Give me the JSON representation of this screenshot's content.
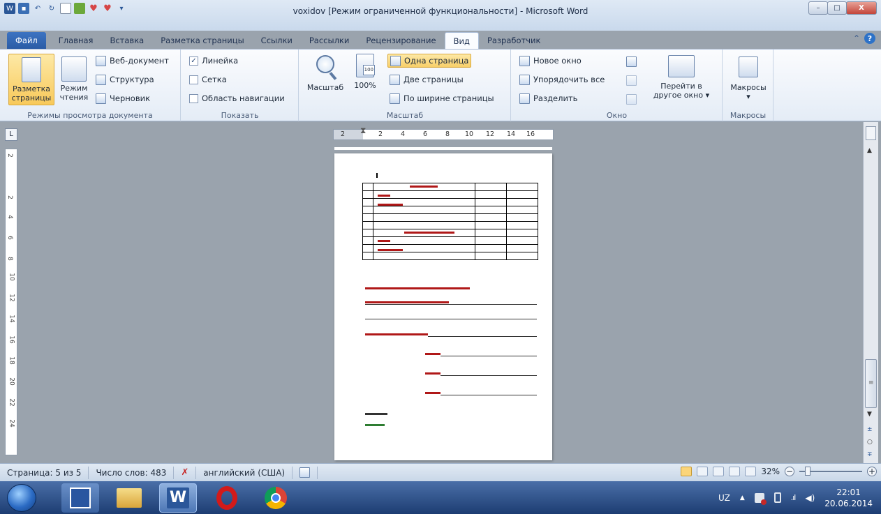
{
  "window": {
    "title": "voxidov [Режим ограниченной функциональности] - Microsoft Word",
    "minimize": "–",
    "maximize": "□",
    "close": "X"
  },
  "tabs": [
    "Файл",
    "Главная",
    "Вставка",
    "Разметка страницы",
    "Ссылки",
    "Рассылки",
    "Рецензирование",
    "Вид",
    "Разработчик"
  ],
  "help": {
    "collapse": "⌃",
    "question": "?"
  },
  "ribbon": {
    "views": {
      "label": "Режимы просмотра документа",
      "page_layout_1": "Разметка",
      "page_layout_2": "страницы",
      "reading_1": "Режим",
      "reading_2": "чтения",
      "web": "Веб-документ",
      "outline": "Структура",
      "draft": "Черновик"
    },
    "show": {
      "label": "Показать",
      "ruler": "Линейка",
      "ruler_checked": "✓",
      "grid": "Сетка",
      "nav_pane": "Область навигации"
    },
    "zoom": {
      "label": "Масштаб",
      "zoom": "Масштаб",
      "hundred": "100%",
      "icon_100": "100",
      "one_page": "Одна страница",
      "two_pages": "Две страницы",
      "page_width": "По ширине страницы"
    },
    "window": {
      "label": "Окно",
      "new_window": "Новое окно",
      "arrange_all": "Упорядочить все",
      "split": "Разделить",
      "switch_1": "Перейти в",
      "switch_2": "другое окно ▾"
    },
    "macros": {
      "label": "Макросы",
      "macros": "Макросы",
      "dropdown": "▾"
    }
  },
  "ruler": {
    "h_marks": [
      "2",
      "2",
      "4",
      "6",
      "8",
      "10",
      "12",
      "14",
      "16"
    ],
    "v_marks": [
      "2",
      "2",
      "4",
      "6",
      "8",
      "10",
      "12",
      "14",
      "16",
      "18",
      "20",
      "22",
      "24"
    ],
    "corner": "L"
  },
  "status": {
    "page": "Страница: 5 из 5",
    "words": "Число слов: 483",
    "language": "английский (США)",
    "zoom": "32%",
    "zoom_minus": "−",
    "zoom_plus": "+"
  },
  "tray": {
    "lang": "UZ",
    "time": "22:01",
    "date": "20.06.2014",
    "show_hidden": "▲"
  },
  "taskbar": {
    "word_letter": "W"
  },
  "scroll": {
    "up": "▲",
    "down": "▼",
    "prev": "±",
    "select": "○",
    "next": "∓",
    "split": "≡"
  },
  "colors": {
    "accent": "#2a5ba5",
    "selected": "#f8c95a",
    "doc_text": "#b01818"
  }
}
